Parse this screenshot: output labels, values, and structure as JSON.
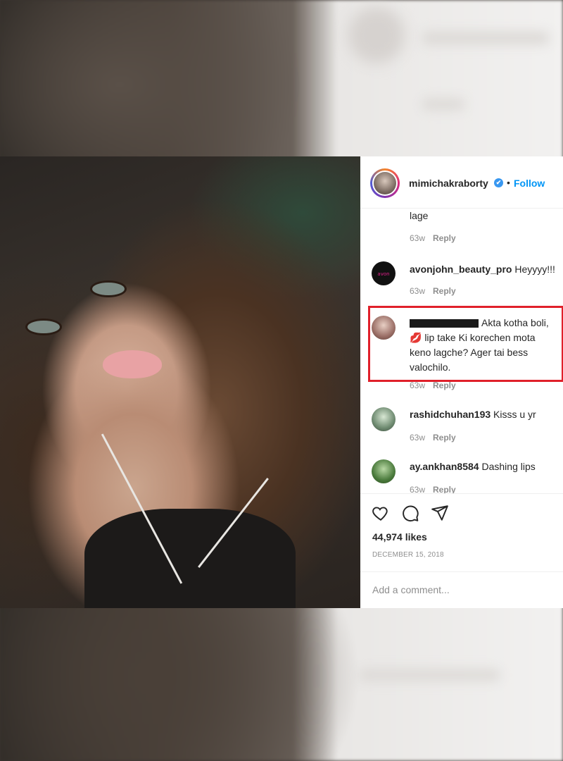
{
  "post": {
    "username": "mimichakraborty",
    "separator": "•",
    "follow_label": "Follow",
    "verified_glyph": "✔",
    "likes": "44,974 likes",
    "date": "DECEMBER 15, 2018",
    "add_comment_placeholder": "Add a comment..."
  },
  "comments": [
    {
      "username": "",
      "text": "lage",
      "time": "63w",
      "reply": "Reply"
    },
    {
      "username": "avonjohn_beauty_pro",
      "text": "Heyyyy!!!",
      "time": "63w",
      "reply": "Reply"
    },
    {
      "username": "",
      "text": "Akta kotha boli, 💋 lip take Ki korechen mota keno lagche? Ager tai bess valochilo.",
      "time": "63w",
      "reply": "Reply",
      "highlighted": true
    },
    {
      "username": "rashidchuhan193",
      "text": "Kisss u yr",
      "time": "63w",
      "reply": "Reply"
    },
    {
      "username": "ay.ankhan8584",
      "text": "Dashing lips",
      "time": "63w",
      "reply": "Reply"
    }
  ],
  "icons": {
    "like": "heart-icon",
    "comment": "comment-bubble-icon",
    "share": "paper-plane-icon",
    "verified": "verified-badge-icon"
  },
  "colors": {
    "link_blue": "#0095f6",
    "highlight_red": "#e0202a",
    "muted_text": "#8e8e8e"
  }
}
